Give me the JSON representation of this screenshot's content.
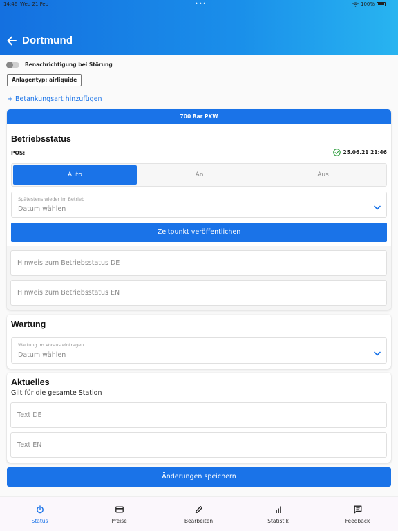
{
  "status_bar": {
    "time": "14:46",
    "date": "Wed 21 Feb",
    "battery": "100%"
  },
  "header": {
    "title": "Dortmund"
  },
  "notification_toggle": {
    "label": "Benachrichtigung bei Störung",
    "on": false
  },
  "plant_type_chip": "Anlagentyp: airliquide",
  "add_fueling_link": "+ Betankungsart hinzufügen",
  "status_card": {
    "topbar": "700 Bar PKW",
    "title": "Betriebsstatus",
    "pos_label": "POS:",
    "pos_timestamp": "25.06.21 21:46",
    "modes": [
      "Auto",
      "An",
      "Aus"
    ],
    "active_mode": "Auto",
    "date_field": {
      "label": "Spätestens wieder im Betrieb",
      "value": "Datum wählen"
    },
    "publish_button": "Zeitpunkt veröffentlichen",
    "hint_de_placeholder": "Hinweis zum Betriebsstatus DE",
    "hint_en_placeholder": "Hinweis zum Betriebsstatus EN"
  },
  "maintenance_card": {
    "title": "Wartung",
    "date_field": {
      "label": "Wartung im Voraus eintragen",
      "value": "Datum wählen"
    }
  },
  "news_card": {
    "title": "Aktuelles",
    "subtitle": "Gilt für die gesamte Station",
    "text_de_placeholder": "Text DE",
    "text_en_placeholder": "Text EN"
  },
  "save_button": "Änderungen speichern",
  "tabs": [
    {
      "label": "Status",
      "icon": "power-icon",
      "active": true
    },
    {
      "label": "Preise",
      "icon": "card-icon",
      "active": false
    },
    {
      "label": "Bearbeiten",
      "icon": "pencil-icon",
      "active": false
    },
    {
      "label": "Statistik",
      "icon": "bar-chart-icon",
      "active": false
    },
    {
      "label": "Feedback",
      "icon": "feedback-icon",
      "active": false
    }
  ],
  "colors": {
    "accent": "#1a73e8",
    "success": "#2e9e3e"
  }
}
